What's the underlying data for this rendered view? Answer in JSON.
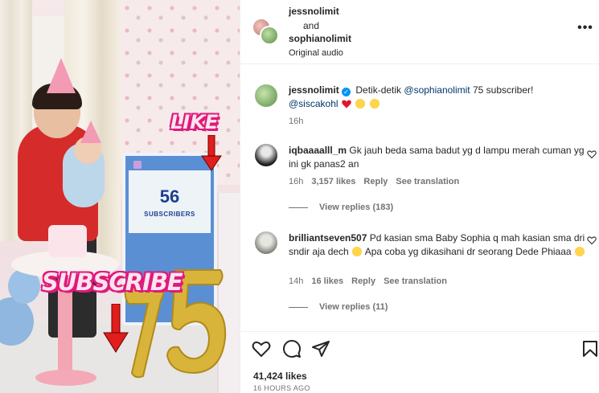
{
  "media": {
    "like_sticker": "LIKE",
    "subscribe_sticker": "SUBSCRIBE",
    "screen_count": "56",
    "screen_label": "SUBSCRIBERS",
    "balloon_digits": "75"
  },
  "header": {
    "user1": "jessnolimit",
    "and_text": "and",
    "user2": "sophianolimit",
    "audio": "Original audio",
    "more": "•••"
  },
  "caption": {
    "username": "jessnolimit",
    "text": "Detik-detik",
    "mention1": "@sophianolimit",
    "text2": "75 subscriber!",
    "mention2": "@siscakohl",
    "time": "16h"
  },
  "comments": [
    {
      "username": "iqbaaaalll_m",
      "text": "Gk jauh beda sama badut yg d lampu merah cuman yg ini gk panas2 an",
      "time": "16h",
      "likes": "3,157 likes",
      "reply": "Reply",
      "translate": "See translation",
      "view_replies": "View replies (183)"
    },
    {
      "username": "brilliantseven507",
      "text_part1": "Pd kasian sma Baby Sophia q mah kasian sma dri sndir aja dech",
      "text_part2": "Apa coba yg dikasihani dr seorang Dede Phiaaa",
      "time": "14h",
      "likes": "16 likes",
      "reply": "Reply",
      "translate": "See translation",
      "view_replies": "View replies (11)"
    }
  ],
  "footer": {
    "likes": "41,424 likes",
    "ago": "16 HOURS AGO"
  },
  "icons": [
    "heart-icon",
    "comment-icon",
    "share-icon",
    "bookmark-icon",
    "verified-icon",
    "more-icon"
  ],
  "colors": {
    "sticker_pink": "#e0197b",
    "screen_blue": "#5b8fd4",
    "shirt_red": "#d62b2b",
    "gold": "#d8b43a",
    "verified_blue": "#0095f6",
    "link_blue": "#00376b",
    "muted_text": "#737373"
  }
}
